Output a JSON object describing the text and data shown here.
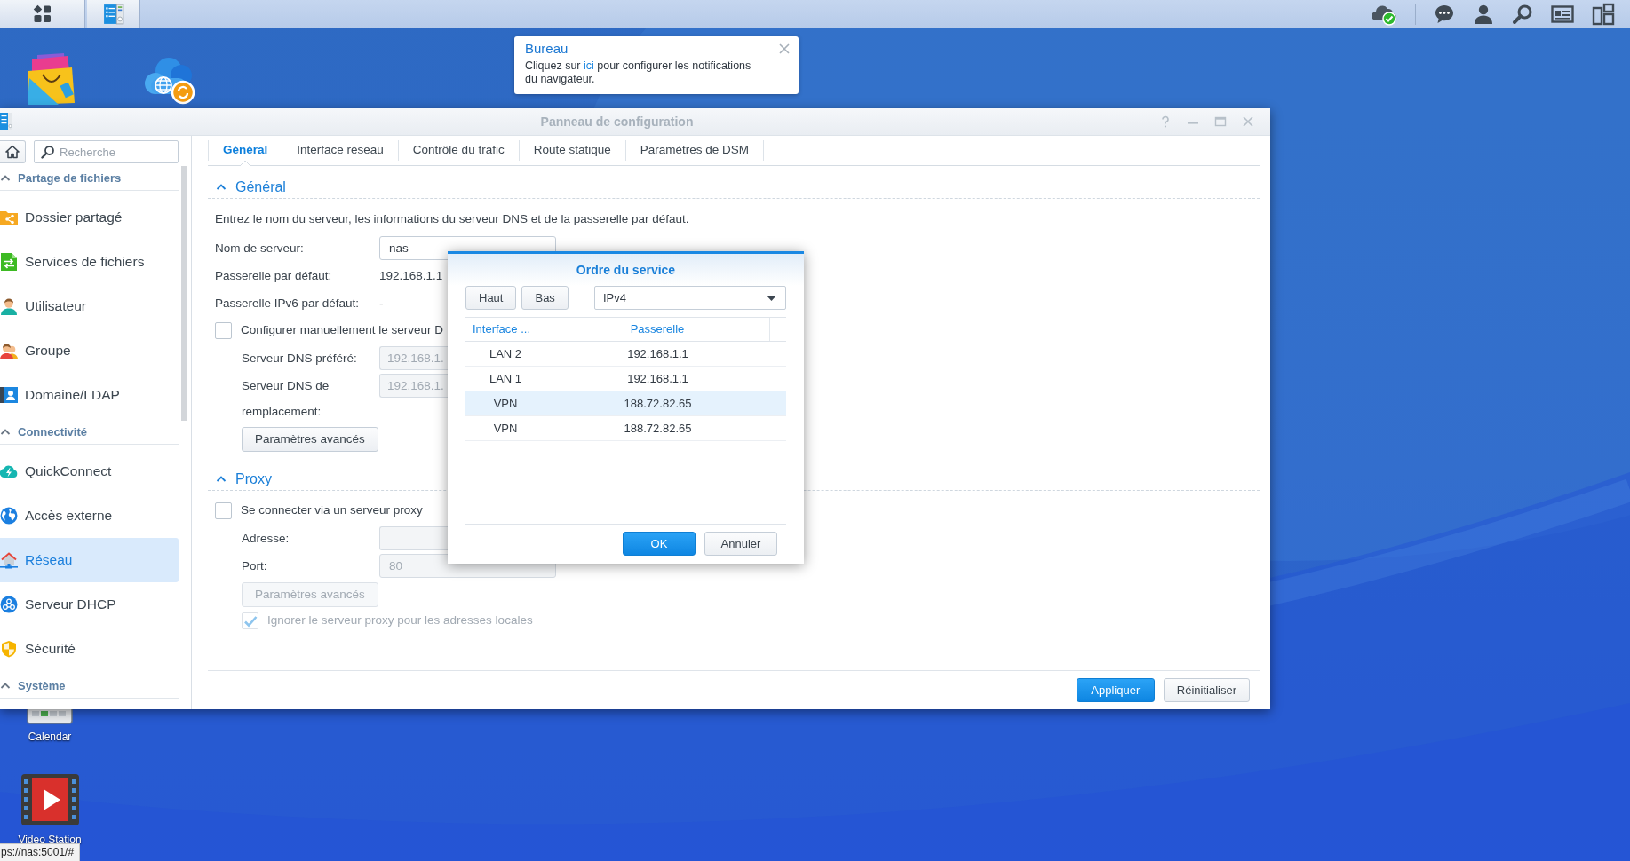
{
  "window": {
    "title": "Panneau de configuration"
  },
  "notification": {
    "title": "Bureau",
    "message_before": "Cliquez sur",
    "link": "ici",
    "message_after": "pour configurer les notifications du navigateur."
  },
  "desktop_icons": [
    {
      "label": "Calendar"
    },
    {
      "label": "Video Station"
    }
  ],
  "sidebar": {
    "search": {
      "placeholder": "Recherche"
    },
    "sections": [
      {
        "title": "Partage de fichiers",
        "expanded": true,
        "items": [
          {
            "label": "Dossier partagé",
            "selected": false
          },
          {
            "label": "Services de fichiers",
            "selected": false
          },
          {
            "label": "Utilisateur",
            "selected": false
          },
          {
            "label": "Groupe",
            "selected": false
          },
          {
            "label": "Domaine/LDAP",
            "selected": false
          }
        ]
      },
      {
        "title": "Connectivité",
        "expanded": true,
        "items": [
          {
            "label": "QuickConnect",
            "selected": false
          },
          {
            "label": "Accès externe",
            "selected": false
          },
          {
            "label": "Réseau",
            "selected": true
          },
          {
            "label": "Serveur DHCP",
            "selected": false
          },
          {
            "label": "Sécurité",
            "selected": false
          }
        ]
      },
      {
        "title": "Système",
        "expanded": true
      }
    ]
  },
  "tabs": [
    {
      "label": "Général",
      "selected": true
    },
    {
      "label": "Interface réseau",
      "selected": false
    },
    {
      "label": "Contrôle du trafic",
      "selected": false
    },
    {
      "label": "Route statique",
      "selected": false
    },
    {
      "label": "Paramètres de DSM",
      "selected": false
    }
  ],
  "sections": [
    {
      "title": "Général",
      "expanded": true,
      "description": "Entrez le nom du serveur, les informations du serveur DNS et de la passerelle par défaut.",
      "fields": [
        {
          "kind": "input",
          "label": "Nom de serveur:",
          "value": "nas",
          "disabled": false
        },
        {
          "kind": "text",
          "label": "Passerelle par défaut:",
          "value": "192.168.1.1"
        },
        {
          "kind": "text",
          "label": "Passerelle IPv6 par défaut:",
          "value": "-"
        },
        {
          "kind": "checkbox",
          "text": "Configurer manuellement le serveur D",
          "checked": false,
          "disabled": false,
          "children": [
            {
              "kind": "input",
              "label": "Serveur DNS préféré:",
              "value": "192.168.1.",
              "disabled": true
            },
            {
              "kind": "input",
              "label": "Serveur DNS de remplacement:",
              "value": "192.168.1.",
              "disabled": true
            },
            {
              "kind": "button",
              "text": "Paramètres avancés",
              "disabled": false
            }
          ]
        }
      ]
    },
    {
      "title": "Proxy",
      "expanded": true,
      "fields": [
        {
          "kind": "checkbox",
          "text": "Se connecter via un serveur proxy",
          "checked": false,
          "disabled": false,
          "children": [
            {
              "kind": "input",
              "label": "Adresse:",
              "disabled": true
            },
            {
              "kind": "input",
              "label": "Port:",
              "value": "80",
              "disabled": true
            },
            {
              "kind": "button",
              "text": "Paramètres avancés",
              "disabled": true
            },
            {
              "kind": "checkbox",
              "text": "Ignorer le serveur proxy pour les adresses locales",
              "checked": true,
              "disabled": true
            }
          ]
        }
      ]
    }
  ],
  "footer_buttons": [
    {
      "label": "Appliquer",
      "kind": "primary"
    },
    {
      "label": "Réinitialiser",
      "kind": "secondary"
    }
  ],
  "dialog": {
    "title": "Ordre du service",
    "buttons": [
      {
        "label": "Haut"
      },
      {
        "label": "Bas"
      }
    ],
    "select": {
      "value": "IPv4"
    },
    "table": {
      "columns": [
        "Interface ...",
        "Passerelle"
      ],
      "rows": [
        {
          "cells": [
            "LAN 2",
            "192.168.1.1"
          ],
          "selected": false
        },
        {
          "cells": [
            "LAN 1",
            "192.168.1.1"
          ],
          "selected": false
        },
        {
          "cells": [
            "VPN",
            "188.72.82.65"
          ],
          "selected": true
        },
        {
          "cells": [
            "VPN",
            "188.72.82.65"
          ],
          "selected": false
        }
      ]
    },
    "actions": [
      {
        "label": "OK",
        "kind": "primary"
      },
      {
        "label": "Annuler",
        "kind": "secondary"
      }
    ]
  },
  "status_bar": {
    "url": "ps://nas:5001/#"
  }
}
